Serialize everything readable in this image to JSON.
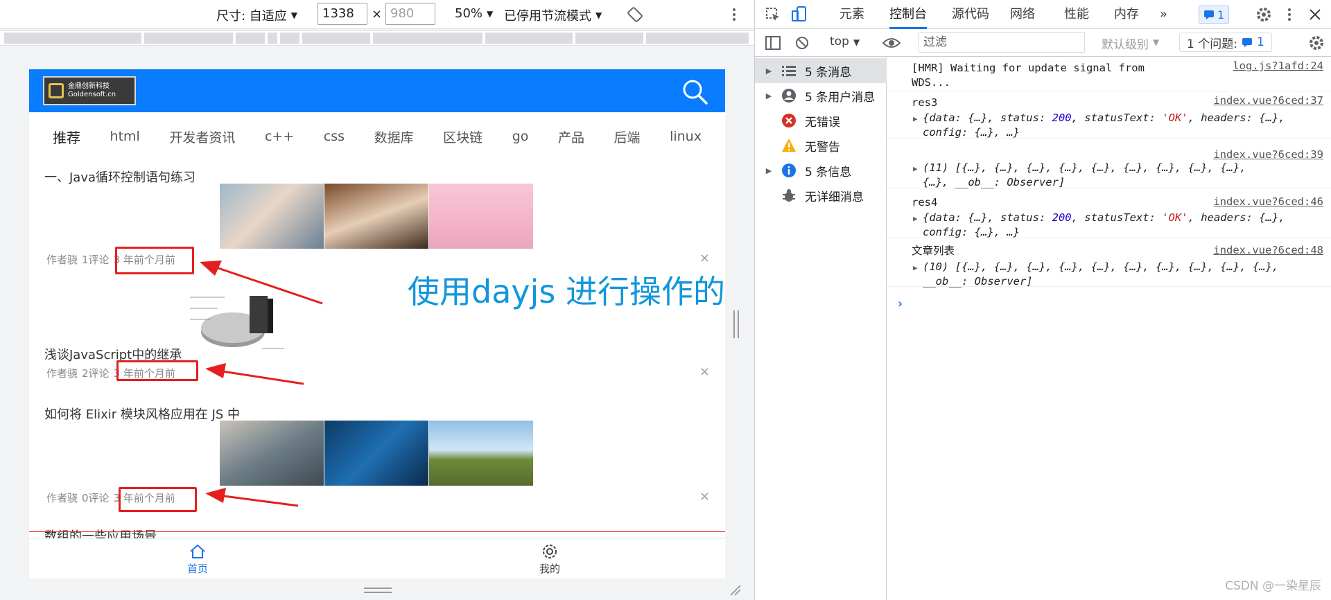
{
  "device_toolbar": {
    "size_label": "尺寸: 自适应",
    "width_value": "1338",
    "times": "×",
    "height_placeholder": "980",
    "zoom": "50%",
    "throttle": "已停用节流模式"
  },
  "app": {
    "logo_text_cn": "金鼎创新科技",
    "logo_text_en": "Goldensoft.cn",
    "categories": [
      "推荐",
      "html",
      "开发者资讯",
      "c++",
      "css",
      "数据库",
      "区块链",
      "go",
      "产品",
      "后端",
      "linux"
    ],
    "articles": [
      {
        "title": "一、Java循环控制语句练习",
        "author": "作者骁",
        "comments": "1评论",
        "time": "3 年前个月前"
      },
      {
        "title": "浅谈JavaScript中的继承",
        "author": "作者骁",
        "comments": "2评论",
        "time": "3 年前个月前"
      },
      {
        "title": "如何将 Elixir 模块风格应用在 JS 中",
        "author": "作者骁",
        "comments": "0评论",
        "time": "3 年前个月前"
      },
      {
        "title": "数组的一些应用场景",
        "author": "",
        "comments": "",
        "time": ""
      }
    ],
    "close_glyph": "×",
    "tabbar": {
      "home": "首页",
      "mine": "我的"
    }
  },
  "annotation": "使用dayjs 进行操作的",
  "devtools": {
    "tabs": [
      "元素",
      "控制台",
      "源代码",
      "网络",
      "性能",
      "内存"
    ],
    "more": "»",
    "issue_count": "1",
    "context": "top",
    "filter_placeholder": "过滤",
    "level": "默认级别",
    "issues_label": "1 个问题:",
    "issues_count": "1",
    "sidebar": [
      {
        "label": "5 条消息",
        "icon": "list-icon"
      },
      {
        "label": "5 条用户消息",
        "icon": "user-icon"
      },
      {
        "label": "无错误",
        "icon": "error-icon"
      },
      {
        "label": "无警告",
        "icon": "warning-icon"
      },
      {
        "label": "5 条信息",
        "icon": "info-icon"
      },
      {
        "label": "无详细消息",
        "icon": "bug-icon"
      }
    ],
    "logs": [
      {
        "line1": "[HMR] Waiting for update signal from",
        "line2": "WDS...",
        "src": "log.js?1afd:24"
      },
      {
        "line1": "res3",
        "src": "index.vue?6ced:37"
      },
      {
        "src": "index.vue?6ced:39"
      },
      {
        "line1": "res4",
        "src": "index.vue?6ced:46"
      },
      {
        "line1": "文章列表",
        "src": "index.vue?6ced:48"
      }
    ],
    "prompt": "›"
  },
  "watermark": "CSDN @一染星辰",
  "colors": {
    "app_header": "#0a7cff",
    "highlight": "#e4201e",
    "annotation": "#1296db"
  }
}
